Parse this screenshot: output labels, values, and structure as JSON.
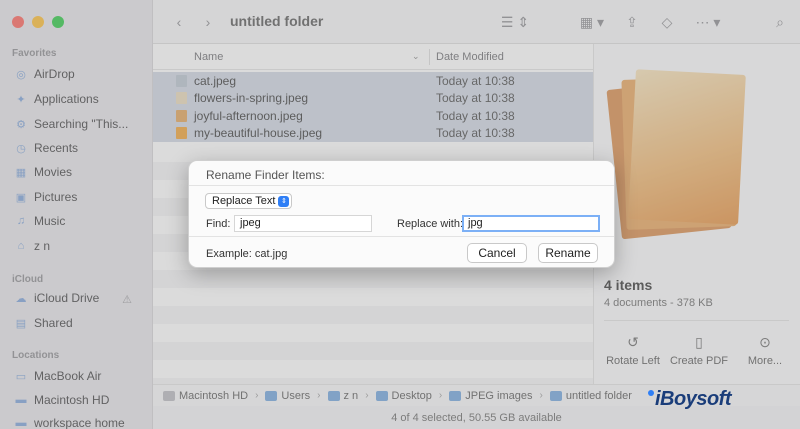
{
  "window": {
    "title": "untitled folder"
  },
  "sidebar": {
    "sections": [
      {
        "title": "Favorites",
        "items": [
          {
            "label": "AirDrop",
            "icon": "airdrop-icon"
          },
          {
            "label": "Applications",
            "icon": "applications-icon"
          },
          {
            "label": "Searching \"This...",
            "icon": "gear-icon"
          },
          {
            "label": "Recents",
            "icon": "clock-icon"
          },
          {
            "label": "Movies",
            "icon": "film-icon"
          },
          {
            "label": "Pictures",
            "icon": "photo-icon"
          },
          {
            "label": "Music",
            "icon": "music-note-icon"
          },
          {
            "label": "z          n",
            "icon": "home-icon"
          }
        ]
      },
      {
        "title": "iCloud",
        "items": [
          {
            "label": "iCloud Drive",
            "icon": "cloud-icon"
          },
          {
            "label": "Shared",
            "icon": "shared-folder-icon"
          }
        ]
      },
      {
        "title": "Locations",
        "items": [
          {
            "label": "MacBook Air",
            "icon": "laptop-icon"
          },
          {
            "label": "Macintosh HD",
            "icon": "disk-icon"
          },
          {
            "label": "workspace home",
            "icon": "disk-icon"
          }
        ]
      }
    ]
  },
  "list": {
    "columns": {
      "name": "Name",
      "date": "Date Modified"
    },
    "rows": [
      {
        "name": "cat.jpeg",
        "date": "Today at 10:38",
        "icon_color": "#b9c3cf"
      },
      {
        "name": "flowers-in-spring.jpeg",
        "date": "Today at 10:38",
        "icon_color": "#e8d9b8"
      },
      {
        "name": "joyful-afternoon.jpeg",
        "date": "Today at 10:38",
        "icon_color": "#e3a254"
      },
      {
        "name": "my-beautiful-house.jpeg",
        "date": "Today at 10:38",
        "icon_color": "#f0a030"
      }
    ]
  },
  "preview": {
    "count": "4 items",
    "meta": "4 documents - 378 KB",
    "actions": [
      {
        "label": "Rotate Left",
        "icon": "rotate-left-icon"
      },
      {
        "label": "Create PDF",
        "icon": "document-icon"
      },
      {
        "label": "More...",
        "icon": "ellipsis-icon"
      }
    ]
  },
  "pathbar": {
    "crumbs": [
      "Macintosh HD",
      "Users",
      "z          n",
      "Desktop",
      "JPEG images",
      "untitled folder"
    ]
  },
  "status": {
    "text": "4 of 4 selected, 50.55 GB available"
  },
  "dialog": {
    "title": "Rename Finder Items:",
    "mode": "Replace Text",
    "find_label": "Find:",
    "find_value": "jpeg",
    "replace_label": "Replace with:",
    "replace_value": "jpg",
    "example": "Example: cat.jpg",
    "cancel_label": "Cancel",
    "rename_label": "Rename"
  },
  "watermark": {
    "text": "iBoysoft"
  },
  "colors": {
    "accent": "#2f7ff6",
    "selection": "#cfd6e3",
    "sidebar_bg": "#e6e4e8"
  }
}
